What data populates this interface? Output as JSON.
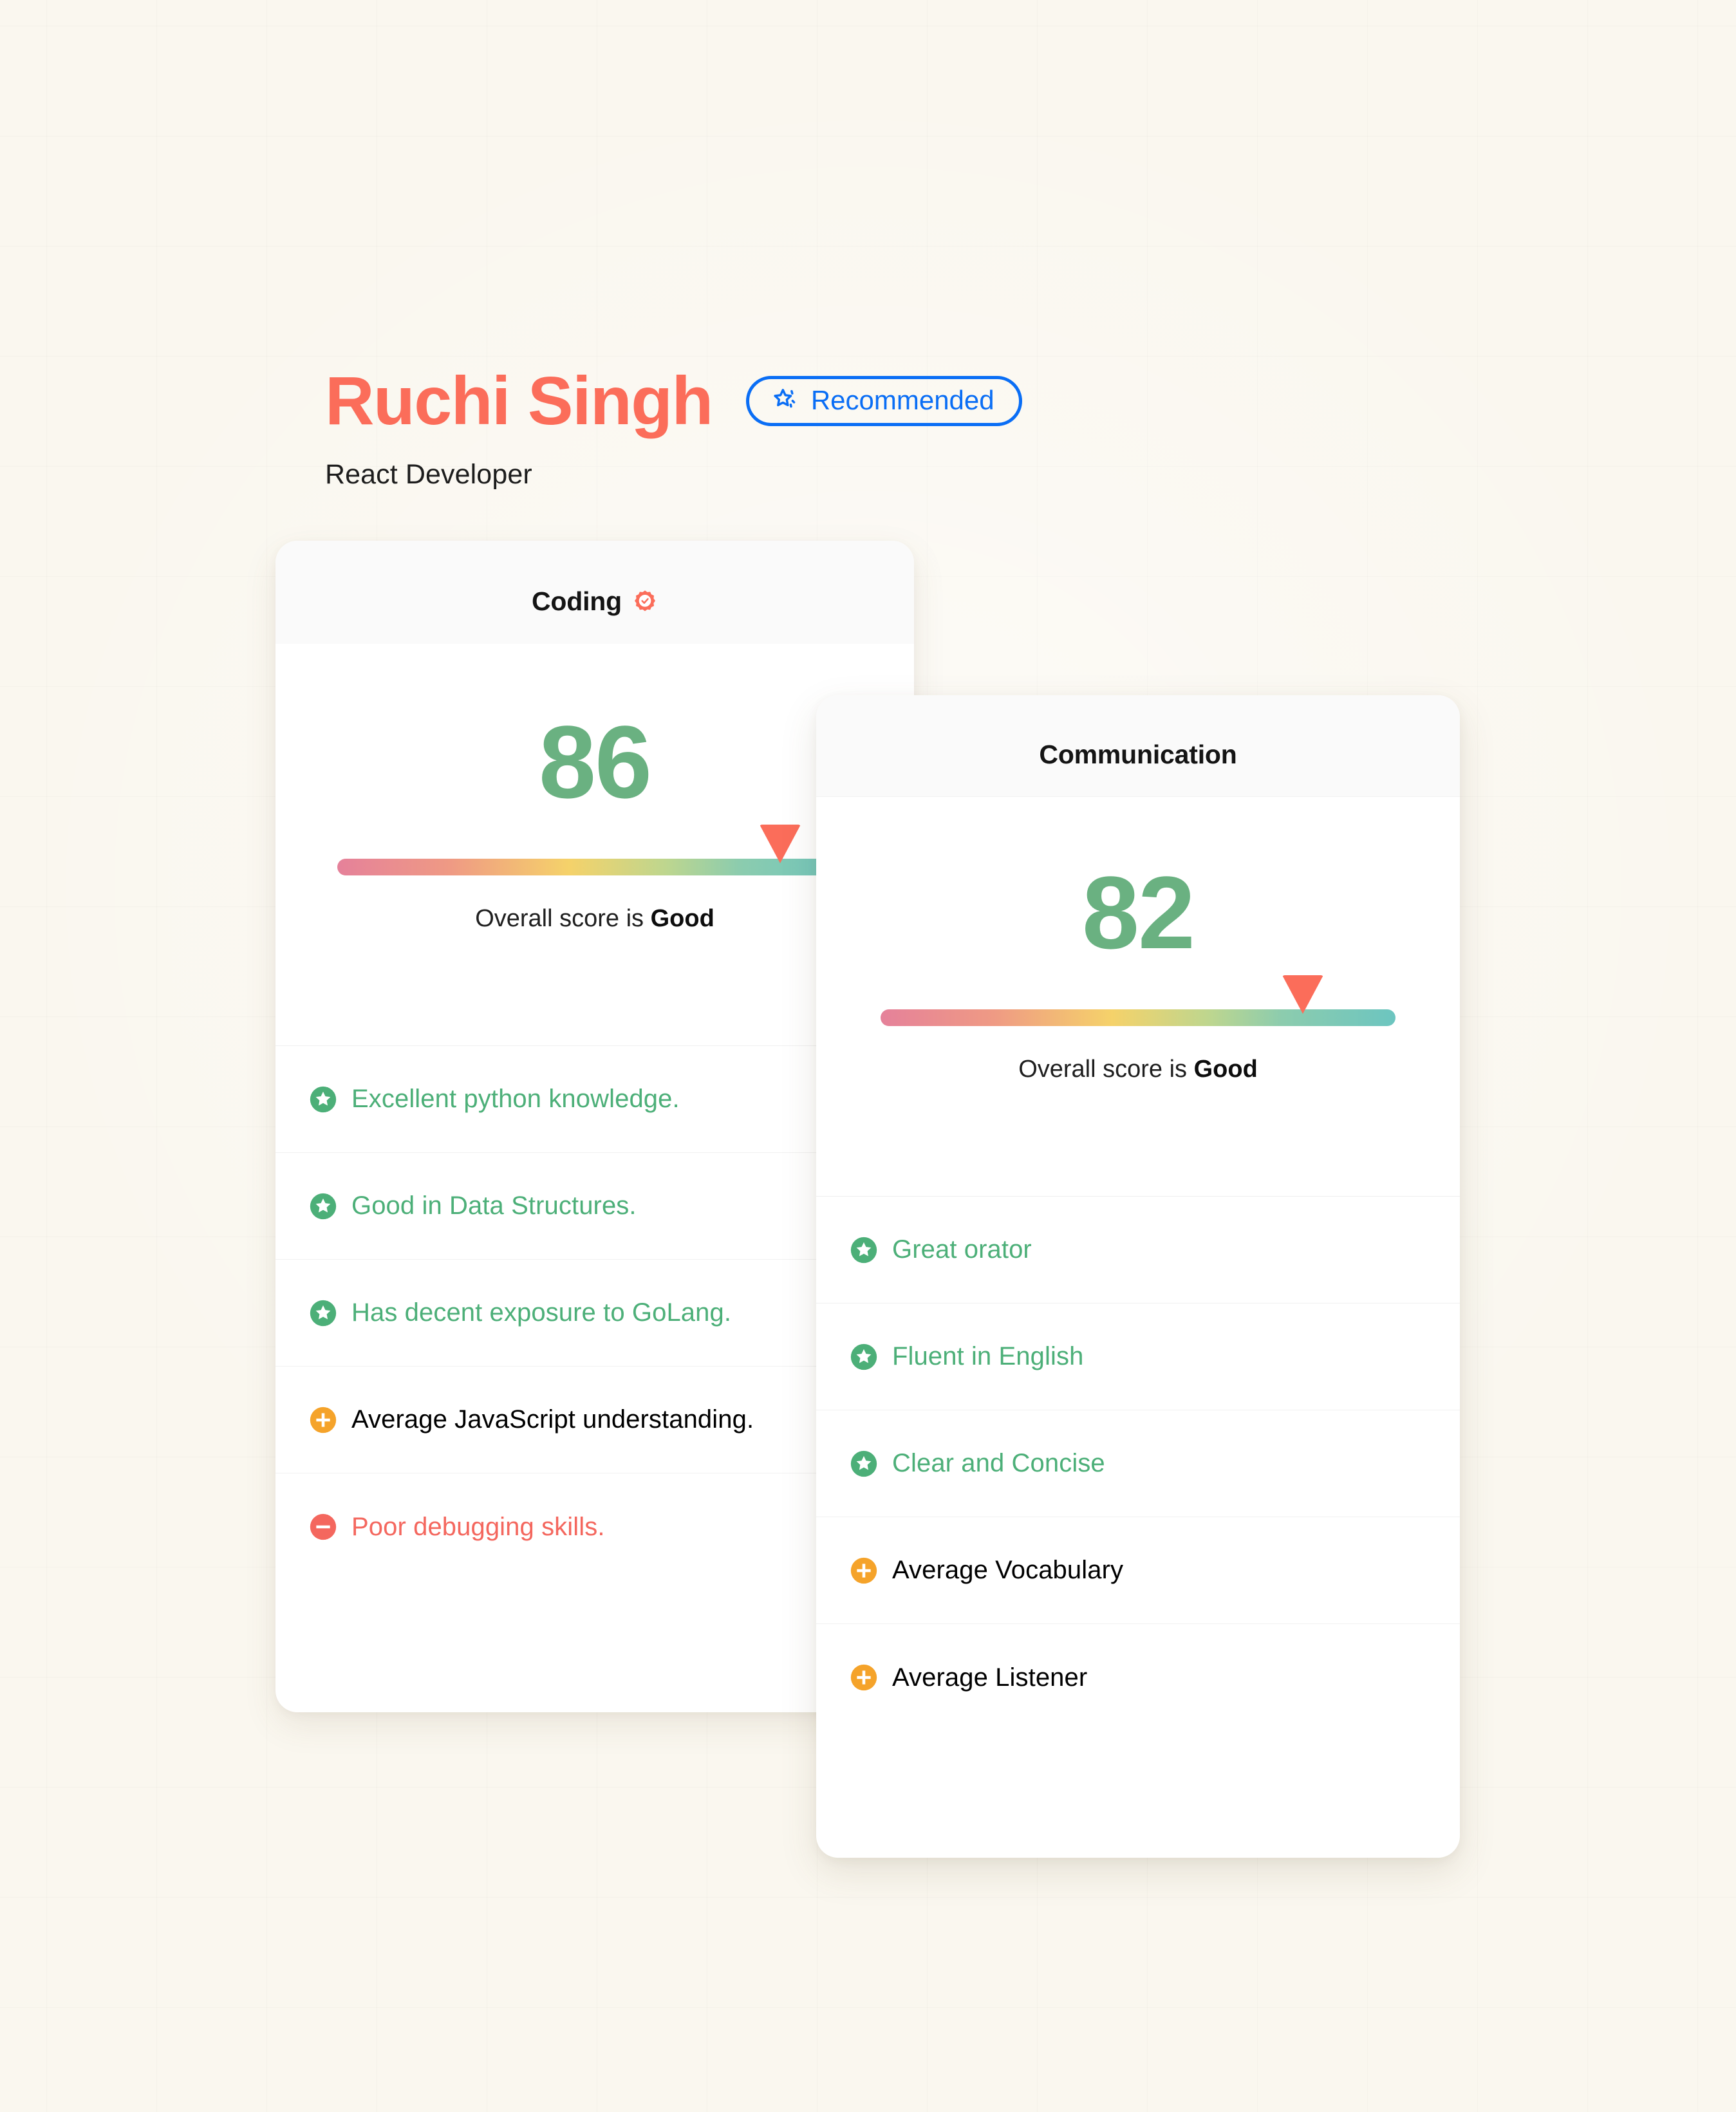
{
  "colors": {
    "page_background": "#faf7ef",
    "name_accent": "#fb6d5a",
    "badge_blue": "#0a6ef5",
    "score_green": "#6ab181",
    "good_green": "#4caf78",
    "average_orange": "#f5a32a",
    "poor_red": "#f4675e",
    "marker_coral": "#fb6d5a",
    "card_white": "#ffffff",
    "card_header": "#fafafa"
  },
  "header": {
    "candidate_name": "Ruchi Singh",
    "role": "React Developer",
    "badge": {
      "label": "Recommended",
      "icon": "star-sparkle-icon"
    }
  },
  "cards": [
    {
      "id": "coding",
      "title": "Coding",
      "title_icon": "verified-badge-icon",
      "score": "86",
      "score_percent": 86,
      "caption_prefix": "Overall score is",
      "caption_rating": "Good",
      "items": [
        {
          "icon": "star-circle-icon",
          "level": "good",
          "text": "Excellent python knowledge."
        },
        {
          "icon": "star-circle-icon",
          "level": "good",
          "text": "Good in Data Structures."
        },
        {
          "icon": "star-circle-icon",
          "level": "good",
          "text": "Has decent exposure to GoLang."
        },
        {
          "icon": "plus-circle-icon",
          "level": "average",
          "text": "Average JavaScript understanding."
        },
        {
          "icon": "minus-circle-icon",
          "level": "poor",
          "text": "Poor debugging skills."
        }
      ]
    },
    {
      "id": "communication",
      "title": "Communication",
      "title_icon": null,
      "score": "82",
      "score_percent": 82,
      "caption_prefix": "Overall score is",
      "caption_rating": "Good",
      "items": [
        {
          "icon": "star-circle-icon",
          "level": "good",
          "text": "Great orator"
        },
        {
          "icon": "star-circle-icon",
          "level": "good",
          "text": "Fluent in English"
        },
        {
          "icon": "star-circle-icon",
          "level": "good",
          "text": "Clear and Concise"
        },
        {
          "icon": "plus-circle-icon",
          "level": "average",
          "text": "Average Vocabulary"
        },
        {
          "icon": "plus-circle-icon",
          "level": "average",
          "text": "Average Listener"
        }
      ]
    }
  ],
  "gauge": {
    "gradient_stops": [
      "#e5819a",
      "#ef9a84",
      "#f5d26a",
      "#bdd68f",
      "#8cccae",
      "#6cc5c0"
    ]
  }
}
